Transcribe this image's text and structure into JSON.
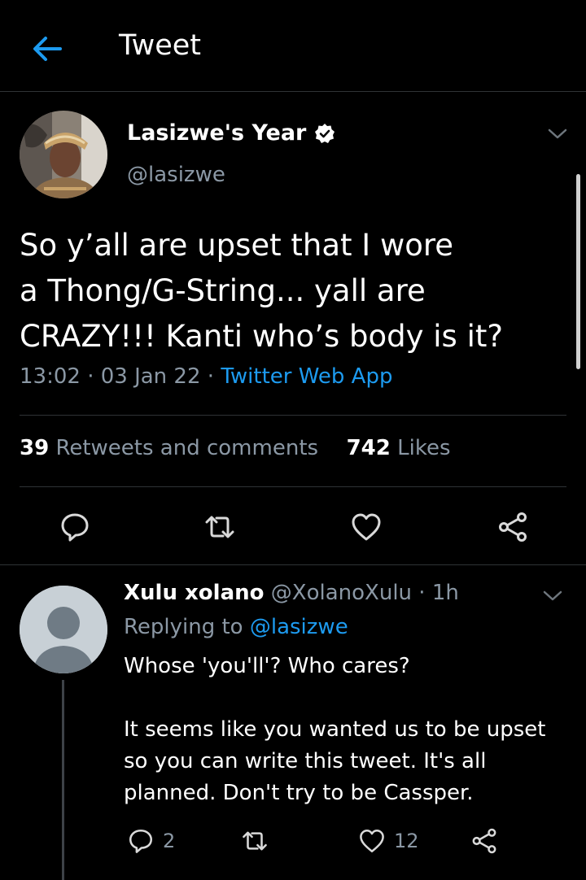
{
  "header": {
    "title": "Tweet"
  },
  "tweet": {
    "author_name": "Lasizwe's Year",
    "author_handle": "@lasizwe",
    "text_lines": [
      "So y’all are upset that I wore",
      "a Thong/G-String... yall are",
      "CRAZY!!! Kanti who’s body is it?"
    ],
    "time": "13:02",
    "date": "03 Jan 22",
    "app": "Twitter Web App",
    "retweets_count": "39",
    "retweets_label": "Retweets and comments",
    "likes_count": "742",
    "likes_label": "Likes"
  },
  "reply": {
    "name": "Xulu xolano",
    "handle": "@XolanoXulu",
    "age": "1h",
    "replying_prefix": "Replying to",
    "replying_to": "@lasizwe",
    "paragraphs": [
      "Whose 'you'll'? Who cares?",
      "It seems like you wanted us to be upset so you can write this tweet. It's all planned. Don't try to be Cassper."
    ],
    "comment_count": "2",
    "like_count": "12"
  },
  "colors": {
    "accent": "#1d9bf0",
    "background": "#000000",
    "muted": "#8b98a5",
    "divider": "#2f3336"
  },
  "icons": [
    "back-arrow-icon",
    "verified-badge-icon",
    "chevron-down-icon",
    "reply-icon",
    "retweet-icon",
    "heart-icon",
    "share-icon"
  ]
}
